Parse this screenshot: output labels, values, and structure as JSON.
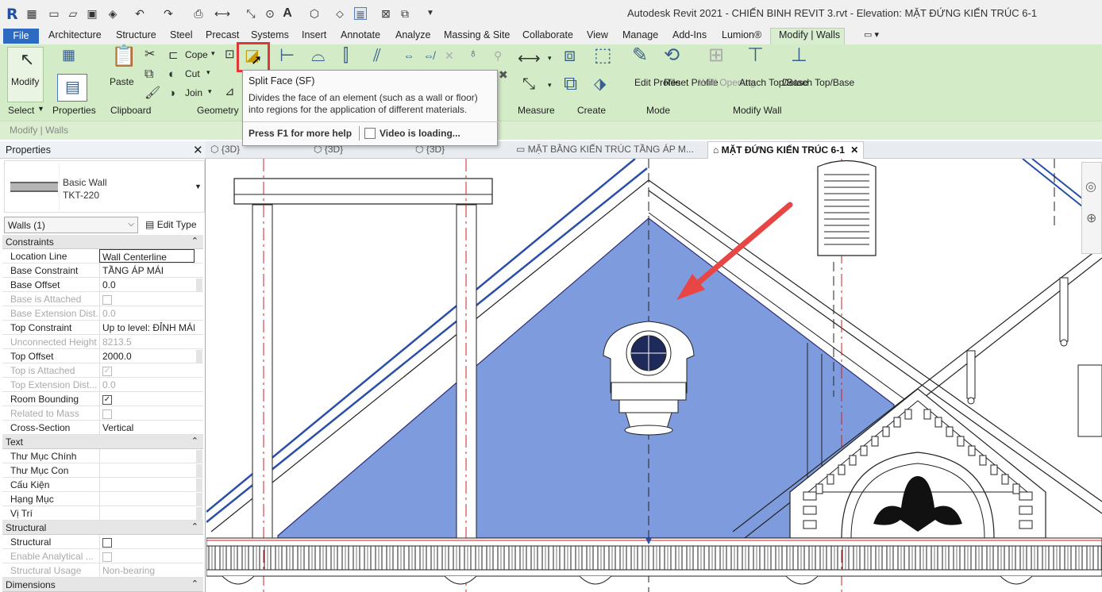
{
  "app": {
    "logo": "R",
    "title": "Autodesk Revit 2021 - CHIẾN BINH REVIT 3.rvt - Elevation: MẶT ĐỨNG KIẾN TRÚC 6-1"
  },
  "menu": {
    "file": "File",
    "tabs": [
      "Architecture",
      "Structure",
      "Steel",
      "Precast",
      "Systems",
      "Insert",
      "Annotate",
      "Analyze",
      "Massing & Site",
      "Collaborate",
      "View",
      "Manage",
      "Add-Ins",
      "Lumion®",
      "Modify | Walls"
    ]
  },
  "ribbon": {
    "modify": "Modify",
    "select": "Select",
    "properties": "Properties",
    "paste": "Paste",
    "clipboard": "Clipboard",
    "cope": "Cope",
    "cut": "Cut",
    "join": "Join",
    "geometry": "Geometry",
    "measure": "Measure",
    "create": "Create",
    "edit_profile": "Edit Profile",
    "reset_profile": "Reset Profile",
    "mode": "Mode",
    "wall_opening": "Wall Opening",
    "attach_top_base": "Attach Top/Base",
    "detach_top_base": "Detach Top/Base",
    "modify_wall": "Modify Wall"
  },
  "context_bar": "Modify | Walls",
  "tooltip": {
    "title": "Split Face",
    "shortcut": "(SF)",
    "description": "Divides the face of an element (such as a wall or floor) into regions for the application of different materials.",
    "help": "Press F1 for more help",
    "video": "Video is loading..."
  },
  "properties": {
    "header": "Properties",
    "type_family": "Basic Wall",
    "type_name": "TKT-220",
    "selector": "Walls (1)",
    "edit_type": "Edit Type",
    "sections": {
      "constraints": "Constraints",
      "text": "Text",
      "structural": "Structural",
      "dimensions": "Dimensions"
    },
    "rows": {
      "location_line": {
        "label": "Location Line",
        "value": "Wall Centerline"
      },
      "base_constraint": {
        "label": "Base Constraint",
        "value": "TẦNG ÁP MÁI"
      },
      "base_offset": {
        "label": "Base Offset",
        "value": "0.0"
      },
      "base_attached": {
        "label": "Base is Attached",
        "value": ""
      },
      "base_ext": {
        "label": "Base Extension Dist...",
        "value": "0.0"
      },
      "top_constraint": {
        "label": "Top Constraint",
        "value": "Up to level: ĐỈNH MÁI"
      },
      "unconnected_height": {
        "label": "Unconnected Height",
        "value": "8213.5"
      },
      "top_offset": {
        "label": "Top Offset",
        "value": "2000.0"
      },
      "top_attached": {
        "label": "Top is Attached",
        "value": ""
      },
      "top_ext": {
        "label": "Top Extension Dist...",
        "value": "0.0"
      },
      "room_bounding": {
        "label": "Room Bounding",
        "value": ""
      },
      "related_mass": {
        "label": "Related to Mass",
        "value": ""
      },
      "cross_section": {
        "label": "Cross-Section",
        "value": "Vertical"
      },
      "thu_muc_chinh": {
        "label": "Thư Mục Chính",
        "value": ""
      },
      "thu_muc_con": {
        "label": "Thư Mục Con",
        "value": ""
      },
      "cau_kien": {
        "label": "Cấu Kiện",
        "value": ""
      },
      "hang_muc": {
        "label": "Hạng Mục",
        "value": ""
      },
      "vi_tri": {
        "label": "Vị Trí",
        "value": ""
      },
      "structural": {
        "label": "Structural",
        "value": ""
      },
      "enable_analytical": {
        "label": "Enable Analytical ...",
        "value": ""
      },
      "structural_usage": {
        "label": "Structural Usage",
        "value": "Non-bearing"
      }
    }
  },
  "view_tabs": [
    "{3D}",
    "{3D}",
    "{3D}",
    "MẶT BẰNG KIẾN TRÚC TẦNG ÁP M...",
    "MẶT ĐỨNG KIẾN TRÚC 6-1"
  ],
  "colors": {
    "accent": "#2d6bc2",
    "highlight": "#e03737",
    "wall_fill": "#7e9bdd",
    "ribbon": "#d3ecc7"
  }
}
